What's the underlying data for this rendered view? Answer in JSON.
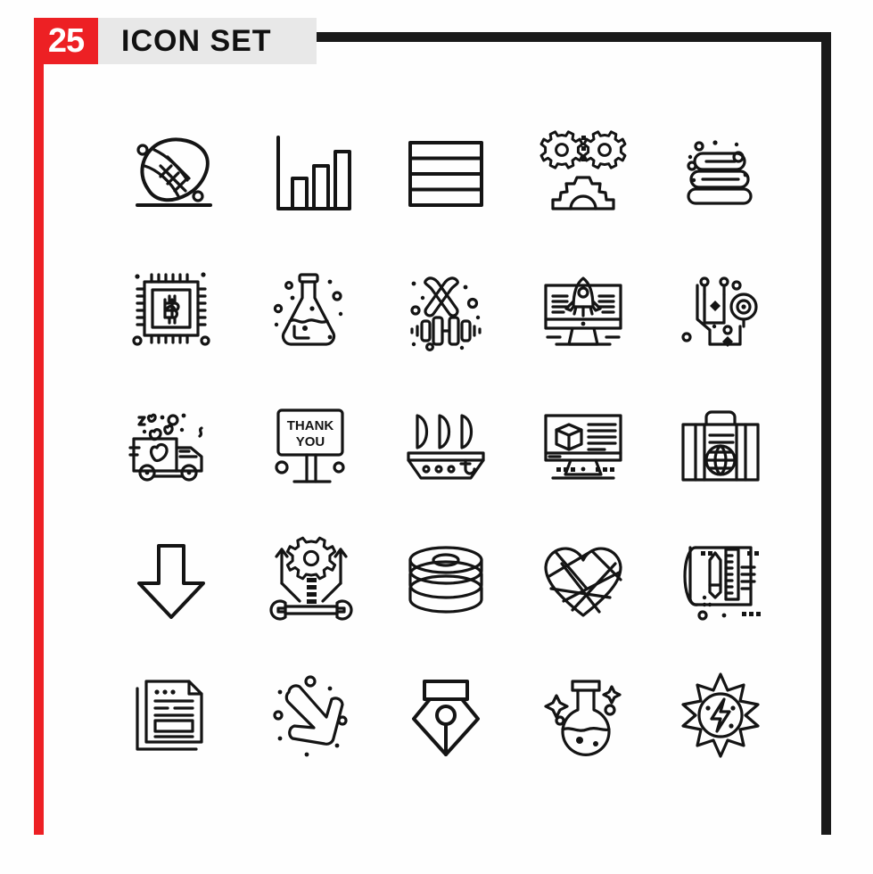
{
  "header": {
    "count_badge": "25",
    "title": "ICON SET",
    "badge_color": "#ed2024",
    "band_color": "#e8e8e8",
    "frame_color": "#1a1a1a"
  },
  "grid": {
    "columns": 5,
    "rows": 5,
    "total_icons": 25,
    "stroke_color": "#141414",
    "icons": [
      {
        "name": "american-football-icon",
        "label": "American Football"
      },
      {
        "name": "bar-chart-icon",
        "label": "Bar Chart"
      },
      {
        "name": "rows-layout-icon",
        "label": "Rows Layout"
      },
      {
        "name": "gears-settings-icon",
        "label": "Gears Settings"
      },
      {
        "name": "stacked-books-icon",
        "label": "Stacked Books"
      },
      {
        "name": "bitcoin-chip-icon",
        "label": "Bitcoin Processor Chip"
      },
      {
        "name": "erlenmeyer-flask-icon",
        "label": "Chemistry Flask"
      },
      {
        "name": "sports-equipment-icon",
        "label": "Bats and Dumbbell"
      },
      {
        "name": "rocket-monitor-icon",
        "label": "Startup Launch Monitor"
      },
      {
        "name": "circuit-board-icon",
        "label": "Circuit Electronics"
      },
      {
        "name": "love-delivery-truck-icon",
        "label": "Love Delivery Truck"
      },
      {
        "name": "thank-you-billboard-icon",
        "label": "Thank You Billboard"
      },
      {
        "name": "sailing-ship-icon",
        "label": "Sailing Ship"
      },
      {
        "name": "product-monitor-icon",
        "label": "Product Box Monitor"
      },
      {
        "name": "travel-suitcase-globe-icon",
        "label": "Travel Suitcase Globe"
      },
      {
        "name": "download-arrow-icon",
        "label": "Download Arrow"
      },
      {
        "name": "gear-wrench-tech-icon",
        "label": "Tech Maintenance Gear"
      },
      {
        "name": "database-stack-icon",
        "label": "Database Stack"
      },
      {
        "name": "geometric-heart-icon",
        "label": "Geometric Heart"
      },
      {
        "name": "blueprint-tools-icon",
        "label": "Blueprint Design Tools"
      },
      {
        "name": "documents-article-icon",
        "label": "Documents Article"
      },
      {
        "name": "down-right-arrow-icon",
        "label": "Down Right Arrow"
      },
      {
        "name": "pen-nib-icon",
        "label": "Pen Nib"
      },
      {
        "name": "round-lab-flask-icon",
        "label": "Round Lab Flask"
      },
      {
        "name": "solar-energy-icon",
        "label": "Solar Energy Sun"
      }
    ]
  },
  "billboard": {
    "line1": "THANK",
    "line2": "YOU"
  }
}
